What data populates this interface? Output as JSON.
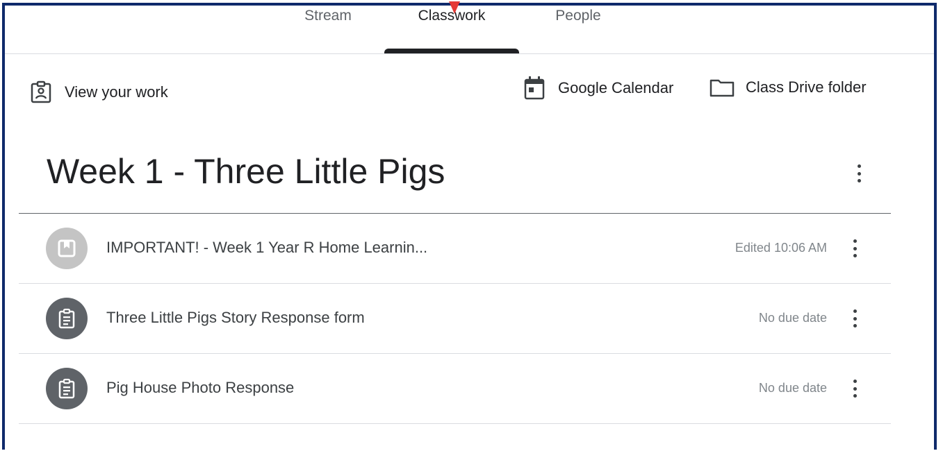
{
  "tabs": [
    {
      "label": "Stream"
    },
    {
      "label": "Classwork"
    },
    {
      "label": "People"
    }
  ],
  "active_tab": "Classwork",
  "toolbar": {
    "view_work": "View your work",
    "google_calendar": "Google Calendar",
    "class_drive": "Class Drive folder"
  },
  "topic": {
    "title": "Week 1 - Three Little Pigs"
  },
  "items": [
    {
      "title": "IMPORTANT! - Week 1 Year R Home Learnin...",
      "meta": "Edited 10:06 AM",
      "icon": "material-icon",
      "icon_bg": "#c4c4c4"
    },
    {
      "title": "Three Little Pigs Story Response form",
      "meta": "No due date",
      "icon": "assignment-icon",
      "icon_bg": "#5f6368"
    },
    {
      "title": "Pig House Photo Response",
      "meta": "No due date",
      "icon": "assignment-icon",
      "icon_bg": "#5f6368"
    }
  ],
  "colors": {
    "frame_border": "#0f2a6b",
    "pointer_arrow": "#e53935"
  }
}
